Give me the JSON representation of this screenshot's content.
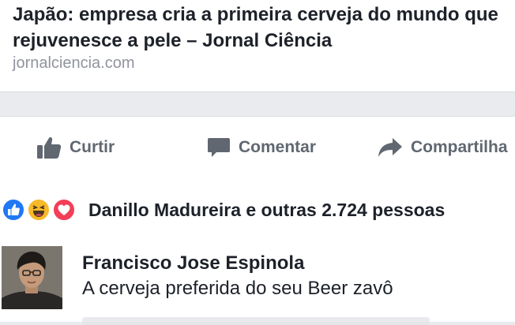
{
  "link_preview": {
    "title": "Japão: empresa cria a primeira cerveja do mundo que rejuvenesce a pele – Jornal Ciência",
    "domain": "jornalciencia.com"
  },
  "actions": {
    "like": {
      "label": "Curtir",
      "icon": "thumbs-up-icon"
    },
    "comment": {
      "label": "Comentar",
      "icon": "comment-bubble-icon"
    },
    "share": {
      "label": "Compartilha",
      "icon": "share-arrow-icon"
    }
  },
  "reactions": {
    "icons": [
      "like-reaction-icon",
      "haha-reaction-icon",
      "love-reaction-icon"
    ],
    "summary": "Danillo Madureira e outras 2.724 pessoas"
  },
  "comment": {
    "author": "Francisco Jose Espinola",
    "text": "A cerveja preferida do seu Beer zavô"
  },
  "colors": {
    "like_blue": "#2078f4",
    "haha_yellow": "#f7b928",
    "love_red": "#f33e58",
    "action_gray": "#606770",
    "text": "#1d2129",
    "muted": "#90949c"
  }
}
